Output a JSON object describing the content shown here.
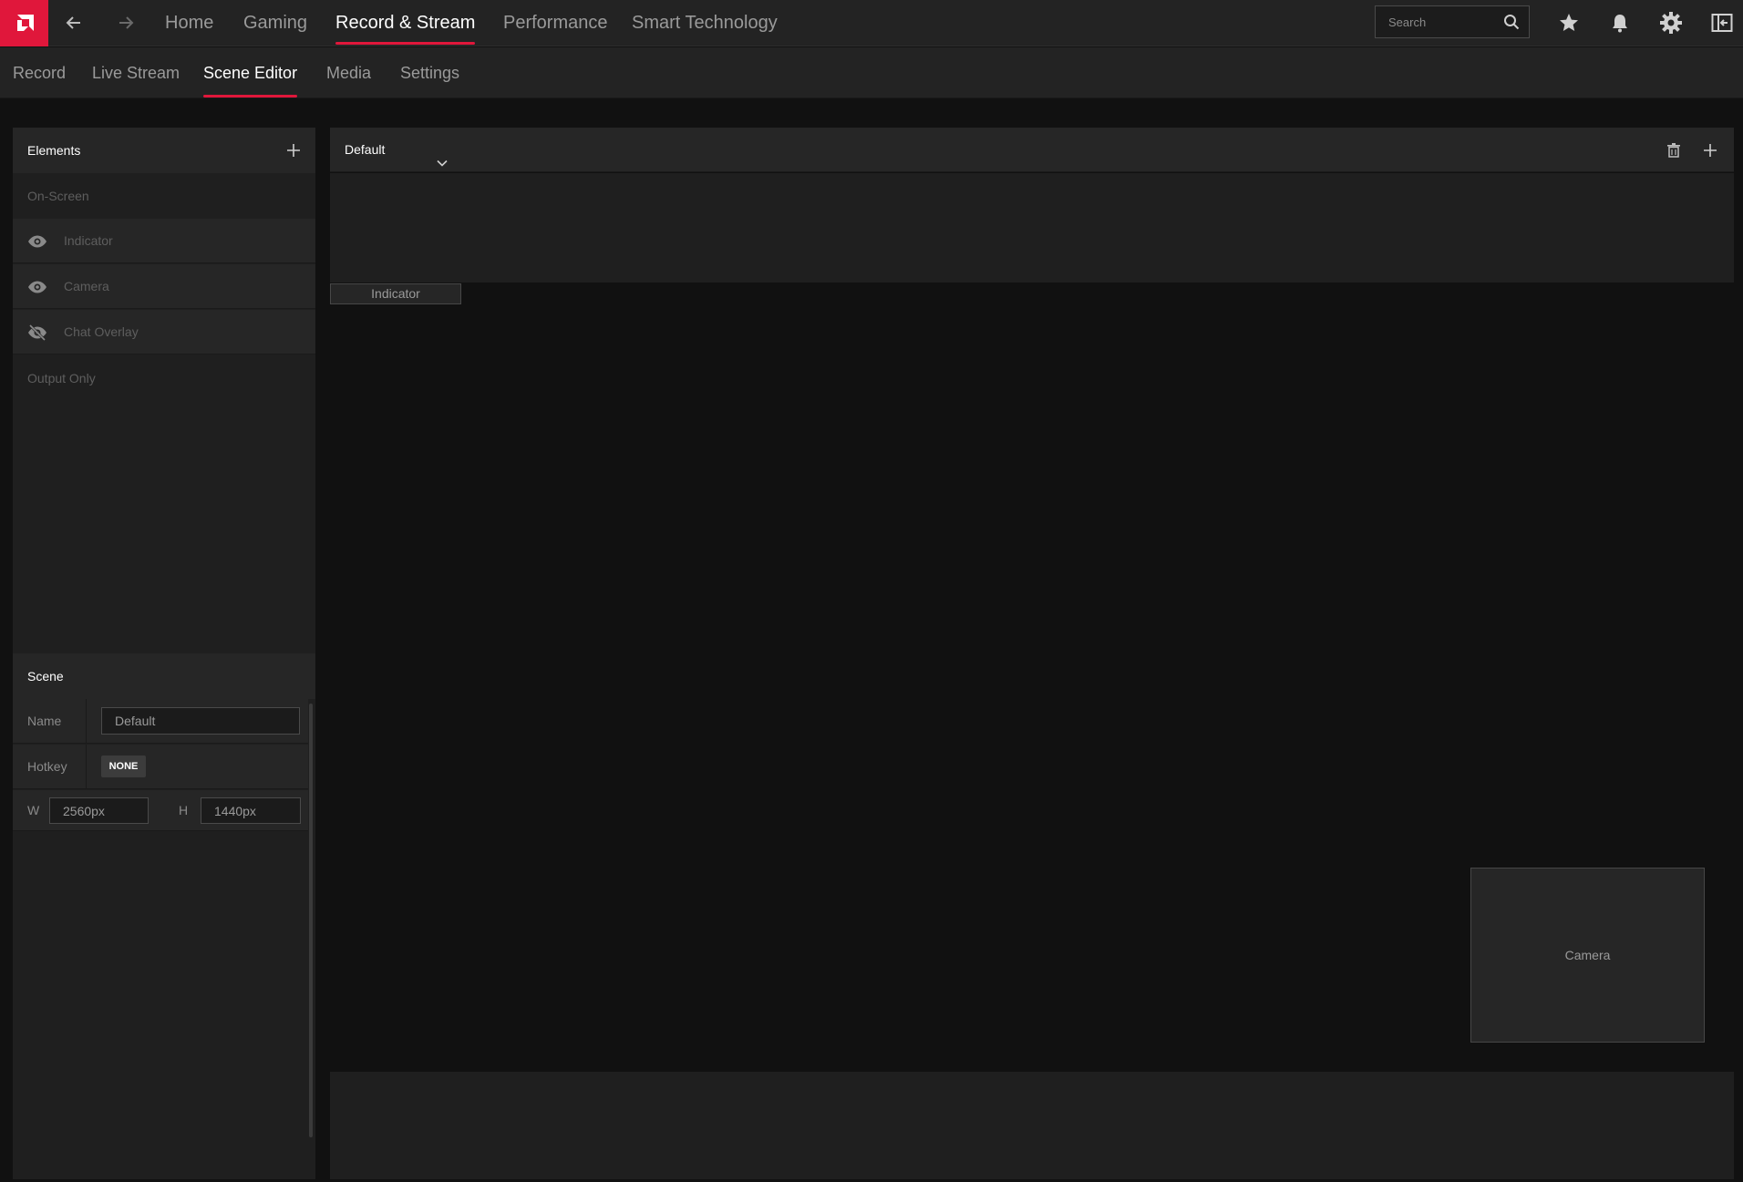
{
  "topbar": {
    "main_tabs": [
      {
        "label": "Home"
      },
      {
        "label": "Gaming"
      },
      {
        "label": "Record & Stream"
      },
      {
        "label": "Performance"
      },
      {
        "label": "Smart Technology"
      }
    ],
    "active_tab": "Record & Stream",
    "search": {
      "placeholder": "Search",
      "value": ""
    },
    "icons": [
      "back-arrow-icon",
      "forward-arrow-icon",
      "search-icon",
      "star-icon",
      "bell-icon",
      "gear-icon",
      "sidebar-collapse-icon"
    ]
  },
  "subtabs": {
    "items": [
      {
        "label": "Record"
      },
      {
        "label": "Live Stream"
      },
      {
        "label": "Scene Editor"
      },
      {
        "label": "Media"
      },
      {
        "label": "Settings"
      }
    ],
    "active": "Scene Editor"
  },
  "elements_panel": {
    "title": "Elements",
    "on_screen_label": "On-Screen",
    "items": [
      {
        "label": "Indicator",
        "visible": true
      },
      {
        "label": "Camera",
        "visible": true
      },
      {
        "label": "Chat Overlay",
        "visible": false
      }
    ],
    "output_only_label": "Output Only"
  },
  "scene_panel": {
    "title": "Scene",
    "name_label": "Name",
    "name_value": "Default",
    "hotkey_label": "Hotkey",
    "hotkey_value": "NONE",
    "width_label": "W",
    "width_value": "2560px",
    "height_label": "H",
    "height_value": "1440px"
  },
  "editor": {
    "scene_selected": "Default",
    "canvas_elements": {
      "indicator": "Indicator",
      "camera": "Camera"
    }
  },
  "colors": {
    "accent": "#e0173b",
    "background": "#111111",
    "panel": "#262626"
  }
}
